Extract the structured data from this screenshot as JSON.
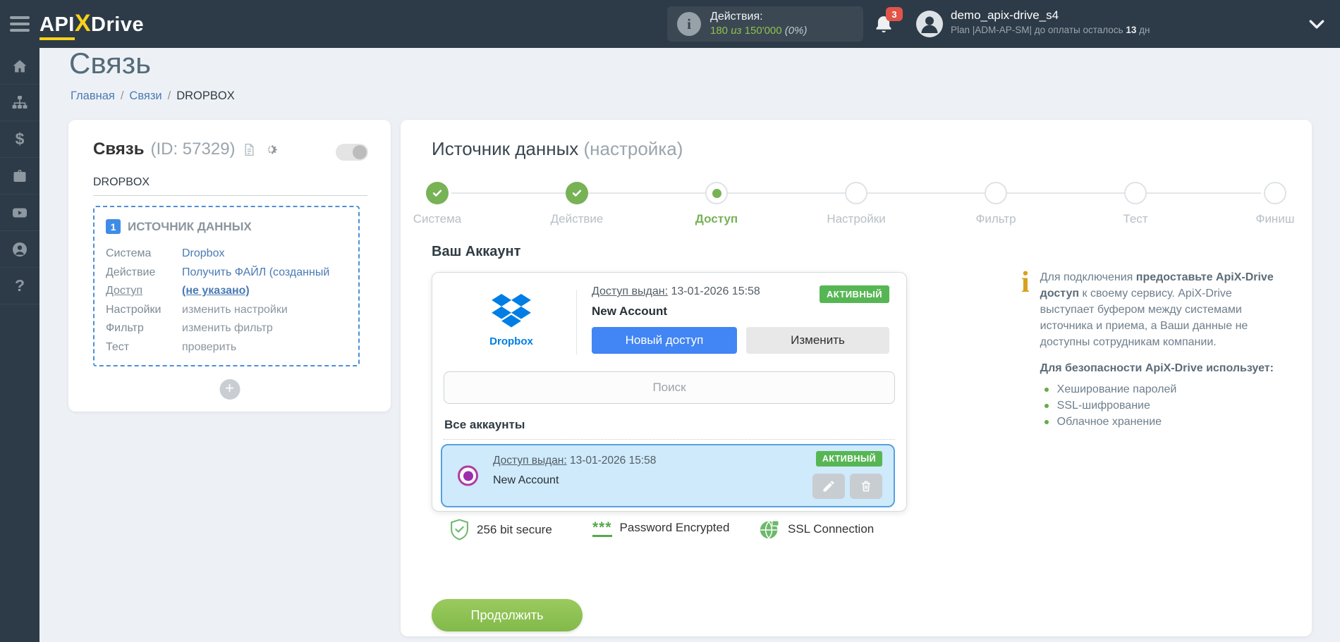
{
  "colors": {
    "topbar_bg": "#2d3b48",
    "accent_yellow": "#f7d21a",
    "link_blue": "#4a7ab5",
    "dashed_border_blue": "#4a90d9",
    "step_green": "#77b255",
    "status_green": "#57b654",
    "button_blue": "#4285f4",
    "dropbox_blue": "#007ee5",
    "selected_item_bg": "#cfeafa",
    "radio_ring": "#b23aa0",
    "radio_dot": "#9a2fae",
    "continue_green": "#8cc152",
    "notif_red": "#e25449",
    "info_amber": "#d8a01c",
    "counter_green": "#8ec04c"
  },
  "icons": {
    "plus": "+",
    "dollar": "$",
    "question": "?",
    "info_i": "i",
    "stars": "***"
  },
  "topbar": {
    "logo": {
      "api": "API",
      "x": "X",
      "drive": "Drive"
    },
    "actions": {
      "label": "Действия:",
      "used": "180",
      "of": "из",
      "total": "150'000",
      "percent": "(0%)"
    },
    "notifications": {
      "count": "3"
    },
    "user": {
      "name": "demo_apix-drive_s4",
      "plan_prefix": "Plan |ADM-AP-SM| до оплаты осталось",
      "days": "13",
      "days_unit": "дн"
    }
  },
  "page": {
    "title": "Связь",
    "breadcrumb": {
      "home": "Главная",
      "separator": "/",
      "connections": "Связи",
      "current": "DROPBOX"
    }
  },
  "connection_card": {
    "title": "Связь",
    "id_text": "(ID: 57329)",
    "name": "DROPBOX",
    "block": {
      "number": "1",
      "title": "ИСТОЧНИК ДАННЫХ",
      "rows": [
        {
          "label": "Система",
          "value": "Dropbox"
        },
        {
          "label": "Действие",
          "value": "Получить ФАЙЛ (созданный"
        },
        {
          "label": "Доступ",
          "value": "(не указано)"
        },
        {
          "label": "Настройки",
          "value": "изменить настройки"
        },
        {
          "label": "Фильтр",
          "value": "изменить фильтр"
        },
        {
          "label": "Тест",
          "value": "проверить"
        }
      ]
    }
  },
  "main": {
    "heading": "Источник данных",
    "heading_suffix": "(настройка)",
    "steps": [
      {
        "label": "Система",
        "state": "done"
      },
      {
        "label": "Действие",
        "state": "done"
      },
      {
        "label": "Доступ",
        "state": "active"
      },
      {
        "label": "Настройки",
        "state": "todo"
      },
      {
        "label": "Фильтр",
        "state": "todo"
      },
      {
        "label": "Тест",
        "state": "todo"
      },
      {
        "label": "Финиш",
        "state": "todo"
      }
    ],
    "account_section": {
      "title": "Ваш Аккаунт",
      "provider": "Dropbox",
      "access_label": "Доступ выдан:",
      "access_date": "13-01-2026 15:58",
      "status": "АКТИВНЫЙ",
      "account_name": "New Account",
      "new_access_button": "Новый доступ",
      "edit_button": "Изменить",
      "search_placeholder": "Поиск",
      "all_accounts_label": "Все аккаунты",
      "list_item": {
        "access_label": "Доступ выдан:",
        "access_date": "13-01-2026 15:58",
        "account_name": "New Account",
        "status": "АКТИВНЫЙ"
      }
    },
    "security": {
      "item1": "256 bit secure",
      "item2": "Password Encrypted",
      "item3": "SSL Connection"
    },
    "continue_button": "Продолжить"
  },
  "info_panel": {
    "p1_regular1": "Для подключения ",
    "p1_bold": "предоставьте ApiX-Drive доступ",
    "p1_regular2": " к своему сервису. ApiX-Drive выступает буфером между системами источника и приема, а Ваши данные не доступны сотрудникам компании.",
    "heading": "Для безопасности ApiX-Drive использует:",
    "bullets": [
      "Хеширование паролей",
      "SSL-шифрование",
      "Облачное хранение"
    ]
  }
}
